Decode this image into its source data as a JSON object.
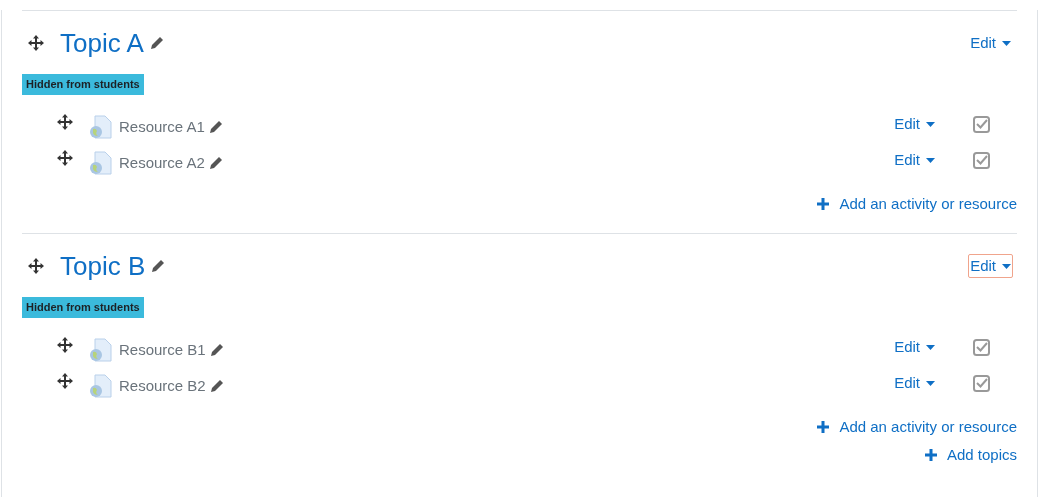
{
  "sections": [
    {
      "title": "Topic A",
      "badge": "Hidden from students",
      "edit_label": "Edit",
      "edit_focused": false,
      "resources": [
        {
          "name": "Resource A1",
          "edit_label": "Edit",
          "checked": true
        },
        {
          "name": "Resource A2",
          "edit_label": "Edit",
          "checked": true
        }
      ],
      "add_label": "Add an activity or resource"
    },
    {
      "title": "Topic B",
      "badge": "Hidden from students",
      "edit_label": "Edit",
      "edit_focused": true,
      "resources": [
        {
          "name": "Resource B1",
          "edit_label": "Edit",
          "checked": true
        },
        {
          "name": "Resource B2",
          "edit_label": "Edit",
          "checked": true
        }
      ],
      "add_label": "Add an activity or resource"
    }
  ],
  "add_topics": "Add topics"
}
